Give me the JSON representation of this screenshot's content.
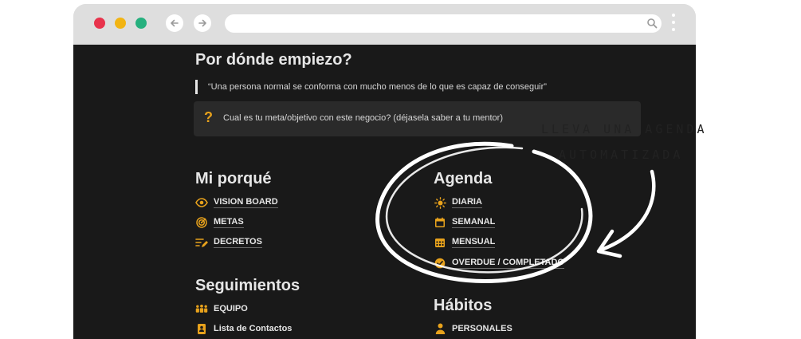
{
  "browser": {
    "url": "",
    "traffic_lights": {
      "red": "#e8334c",
      "yellow": "#f2b413",
      "green": "#26b07e"
    }
  },
  "page": {
    "title": "Por dónde empiezo?",
    "quote": "“Una persona normal se conforma con mucho menos de lo que es capaz de conseguir”",
    "callout": {
      "icon": "question-icon",
      "text": "Cual es tu meta/objetivo con este negocio? (déjasela saber a tu mentor)"
    },
    "mi_porque": {
      "heading": "Mi porqué",
      "items": [
        {
          "label": "VISION BOARD",
          "icon": "eye-icon"
        },
        {
          "label": "METAS",
          "icon": "target-icon"
        },
        {
          "label": "DECRETOS",
          "icon": "write-list-icon"
        }
      ]
    },
    "agenda": {
      "heading": "Agenda",
      "items": [
        {
          "label": "DIARIA",
          "icon": "sun-icon"
        },
        {
          "label": "SEMANAL",
          "icon": "calendar-icon"
        },
        {
          "label": "MENSUAL",
          "icon": "calendar-grid-icon"
        },
        {
          "label": "OVERDUE / COMPLETADO",
          "icon": "check-circle-icon"
        }
      ]
    },
    "seguimientos": {
      "heading": "Seguimientos",
      "items": [
        {
          "label": "EQUIPO",
          "icon": "team-icon"
        },
        {
          "label": "Lista de Contactos",
          "icon": "contacts-icon"
        }
      ]
    },
    "habitos": {
      "heading": "Hábitos",
      "items": [
        {
          "label": "PERSONALES",
          "icon": "person-icon"
        }
      ]
    },
    "accent_color": "#e8a21c"
  },
  "annotation": {
    "line1": "LLEVA UNA AGENDA",
    "line2": "AUTOMATIZADA"
  }
}
